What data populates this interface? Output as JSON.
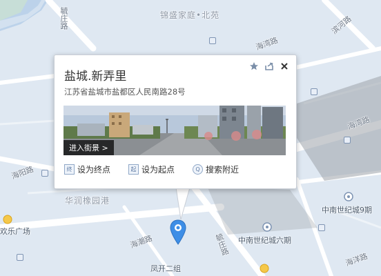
{
  "map": {
    "labels": {
      "top_area": "锦盛家庭•北苑",
      "road_top_left": "毓庄路",
      "road_binhe": "滨河路",
      "road_haiwan_top": "海湾路",
      "road_haiwan_right": "海湾路",
      "road_haiyang_left": "海阳路",
      "road_haichao": "海潮路",
      "road_yuzhuang_bottom": "毓庄路",
      "road_haiyang_bottom": "海洋路",
      "runjuan": "华润橡园港",
      "zhongnan9": "中南世纪城9期",
      "zhongnan6": "中南世纪城六期",
      "huanle": "欢乐广场",
      "fengkai": "凤开二组"
    },
    "colors": {
      "road": "#ffffff",
      "land": "#dfe8f2",
      "water": "#bcd2ea",
      "green": "#cfe6c9",
      "pin": "#3e8ee6"
    }
  },
  "popup": {
    "title": "盐城.新弄里",
    "address": "江苏省盐城市盐都区人民南路28号",
    "street_view_button": "进入街景 >",
    "actions": [
      {
        "icon": "终",
        "label": "设为终点"
      },
      {
        "icon": "起",
        "label": "设为起点"
      },
      {
        "icon": "Q",
        "label": "搜索附近"
      }
    ],
    "icons": [
      "star-icon",
      "share-icon",
      "close-icon"
    ]
  }
}
